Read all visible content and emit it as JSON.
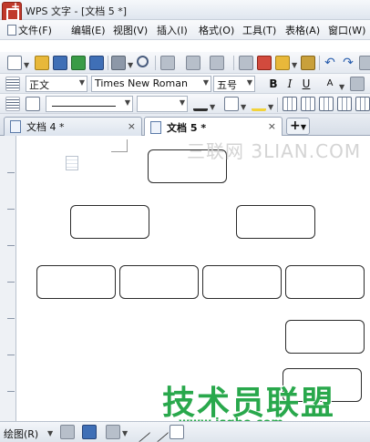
{
  "window": {
    "title": "WPS 文字 - [文档 5 *]"
  },
  "menu": [
    {
      "label": "文件(F)",
      "name": "menu-file"
    },
    {
      "label": "编辑(E)",
      "name": "menu-edit"
    },
    {
      "label": "视图(V)",
      "name": "menu-view"
    },
    {
      "label": "插入(I)",
      "name": "menu-insert"
    },
    {
      "label": "格式(O)",
      "name": "menu-format"
    },
    {
      "label": "工具(T)",
      "name": "menu-tools"
    },
    {
      "label": "表格(A)",
      "name": "menu-table"
    },
    {
      "label": "窗口(W)",
      "name": "menu-window"
    }
  ],
  "format": {
    "style": "正文",
    "font": "Times New Roman",
    "size": "五号",
    "bold": "B",
    "italic": "I",
    "underline": "U",
    "font_color": "A"
  },
  "tabs": [
    {
      "label": "文档 4 *",
      "active": false
    },
    {
      "label": "文档 5 *",
      "active": true
    }
  ],
  "tab_close_glyph": "×",
  "new_tab_glyph": "+",
  "watermarks": {
    "top": "三联网 3LIAN.COM",
    "main": "技术员联盟",
    "url": "www.jsgho.com",
    "main_color": "#29a84c"
  },
  "drawing_toolbar": {
    "label": "绘图(R)"
  },
  "colors": {
    "accent": "#2b5fae",
    "logo": "#c0392b"
  },
  "icons": [
    "new-doc-icon",
    "open-folder-icon",
    "save-icon",
    "export-icon",
    "print-icon",
    "print-preview-icon",
    "undo-icon",
    "redo-icon"
  ]
}
